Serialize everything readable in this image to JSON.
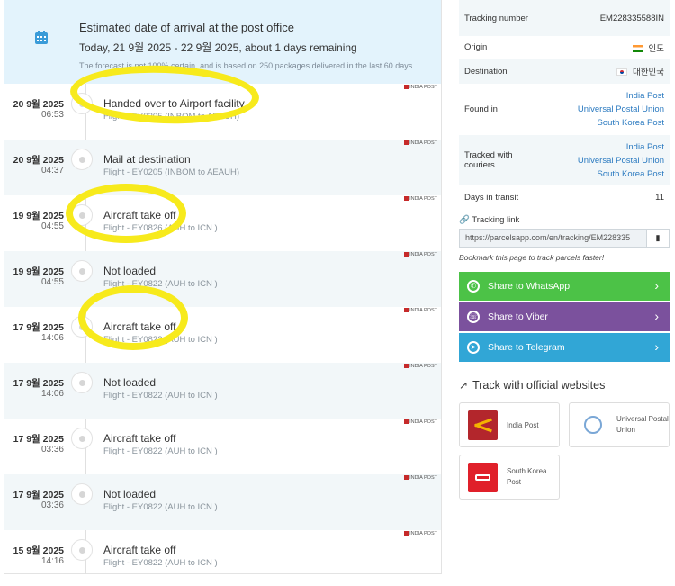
{
  "banner": {
    "title": "Estimated date of arrival at the post office",
    "range": "Today, 21 9월 2025 - 22 9월 2025, about 1 days remaining",
    "note": "The forecast is not 100% certain, and is based on 250 packages delivered in the last 60 days",
    "icon": "calendar-icon"
  },
  "events": [
    {
      "date": "20 9월 2025",
      "time": "06:53",
      "title": "Handed over to Airport facility",
      "detail": "Flight - EY0205 (INBOM to AEAUH)",
      "carrier": "INDIA POST"
    },
    {
      "date": "20 9월 2025",
      "time": "04:37",
      "title": "Mail at destination",
      "detail": "Flight - EY0205 (INBOM to AEAUH)",
      "carrier": "INDIA POST"
    },
    {
      "date": "19 9월 2025",
      "time": "04:55",
      "title": "Aircraft take off",
      "detail": "Flight - EY0826 (AUH to ICN )",
      "carrier": "INDIA POST"
    },
    {
      "date": "19 9월 2025",
      "time": "04:55",
      "title": "Not loaded",
      "detail": "Flight - EY0822 (AUH to ICN )",
      "carrier": "INDIA POST"
    },
    {
      "date": "17 9월 2025",
      "time": "14:06",
      "title": "Aircraft take off",
      "detail": "Flight - EY0822 (AUH to ICN )",
      "carrier": "INDIA POST"
    },
    {
      "date": "17 9월 2025",
      "time": "14:06",
      "title": "Not loaded",
      "detail": "Flight - EY0822 (AUH to ICN )",
      "carrier": "INDIA POST"
    },
    {
      "date": "17 9월 2025",
      "time": "03:36",
      "title": "Aircraft take off",
      "detail": "Flight - EY0822 (AUH to ICN )",
      "carrier": "INDIA POST"
    },
    {
      "date": "17 9월 2025",
      "time": "03:36",
      "title": "Not loaded",
      "detail": "Flight - EY0822 (AUH to ICN )",
      "carrier": "INDIA POST"
    },
    {
      "date": "15 9월 2025",
      "time": "14:16",
      "title": "Aircraft take off",
      "detail": "Flight - EY0822 (AUH to ICN )",
      "carrier": "INDIA POST"
    }
  ],
  "info": {
    "tracking_number_label": "Tracking number",
    "tracking_number": "EM228335588IN",
    "origin_label": "Origin",
    "origin": "인도",
    "destination_label": "Destination",
    "destination": "대한민국",
    "found_in_label": "Found in",
    "found_in": [
      "India Post",
      "Universal Postal Union",
      "South Korea Post"
    ],
    "tracked_with_label": "Tracked with couriers",
    "tracked_with": [
      "India Post",
      "Universal Postal Union",
      "South Korea Post"
    ],
    "days_label": "Days in transit",
    "days": "11"
  },
  "tracking_link": {
    "label": "Tracking link",
    "url": "https://parcelsapp.com/en/tracking/EM228335",
    "bookmark": "Bookmark this page to track parcels faster!"
  },
  "share": [
    {
      "label": "Share to WhatsApp",
      "color": "#4cc247"
    },
    {
      "label": "Share to Viber",
      "color": "#7b519d"
    },
    {
      "label": "Share to Telegram",
      "color": "#31a6d6"
    }
  ],
  "official": {
    "heading": "Track with official websites",
    "cards": [
      "India Post",
      "Universal Postal Union",
      "South Korea Post"
    ]
  },
  "colors": {
    "highlight": "#f7ea1c",
    "link": "#2b7ac0",
    "banner_bg": "#e3f3fc"
  }
}
